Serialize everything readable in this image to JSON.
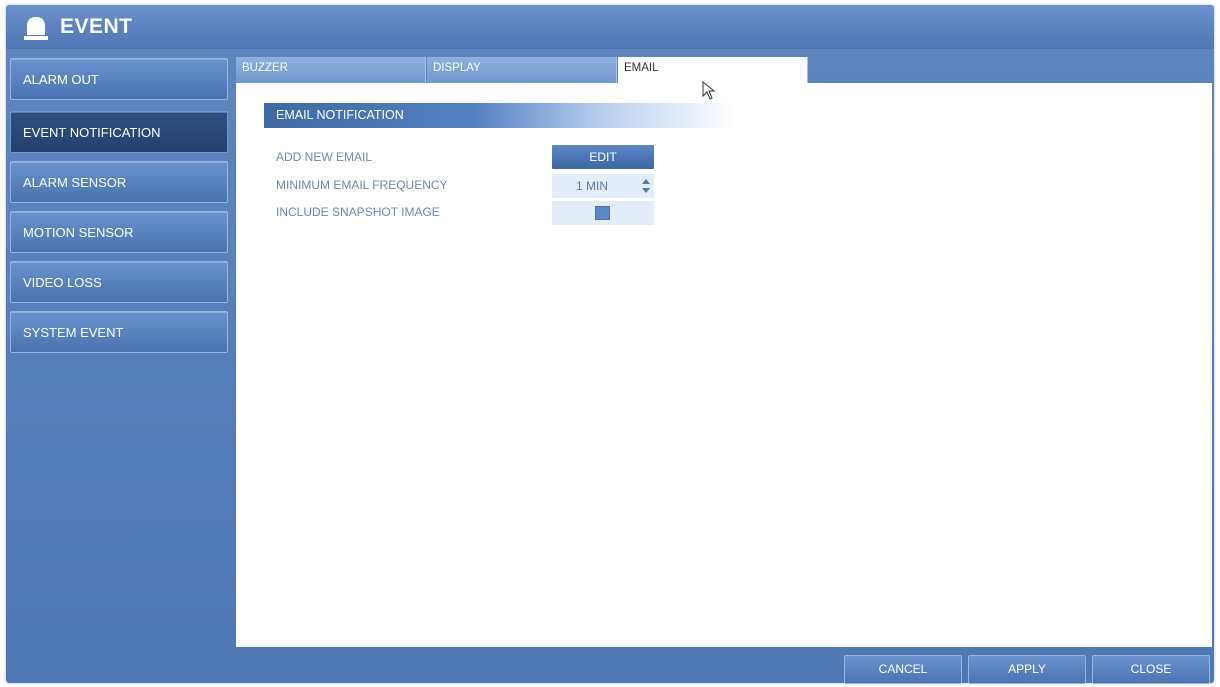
{
  "window": {
    "title": "EVENT",
    "icon": "siren-icon"
  },
  "sidebar": {
    "items": [
      {
        "label": "ALARM OUT"
      },
      {
        "label": "EVENT NOTIFICATION",
        "active": true
      },
      {
        "label": "ALARM SENSOR"
      },
      {
        "label": "MOTION SENSOR"
      },
      {
        "label": "VIDEO LOSS"
      },
      {
        "label": "SYSTEM EVENT"
      }
    ]
  },
  "tabs": [
    {
      "label": "BUZZER"
    },
    {
      "label": "DISPLAY"
    },
    {
      "label": "EMAIL",
      "active": true
    }
  ],
  "email": {
    "section_title": "EMAIL NOTIFICATION",
    "add_new_email_label": "ADD NEW EMAIL",
    "edit_button": "EDIT",
    "min_freq_label": "MINIMUM EMAIL FREQUENCY",
    "min_freq_value": "1 MIN",
    "snapshot_label": "INCLUDE SNAPSHOT IMAGE",
    "snapshot_checked": true
  },
  "footer": {
    "cancel": "CANCEL",
    "apply": "APPLY",
    "close": "CLOSE"
  },
  "colors": {
    "accent": "#4f77b4",
    "active_sidebar": "#2a4878",
    "label_text": "#6f88ad"
  }
}
